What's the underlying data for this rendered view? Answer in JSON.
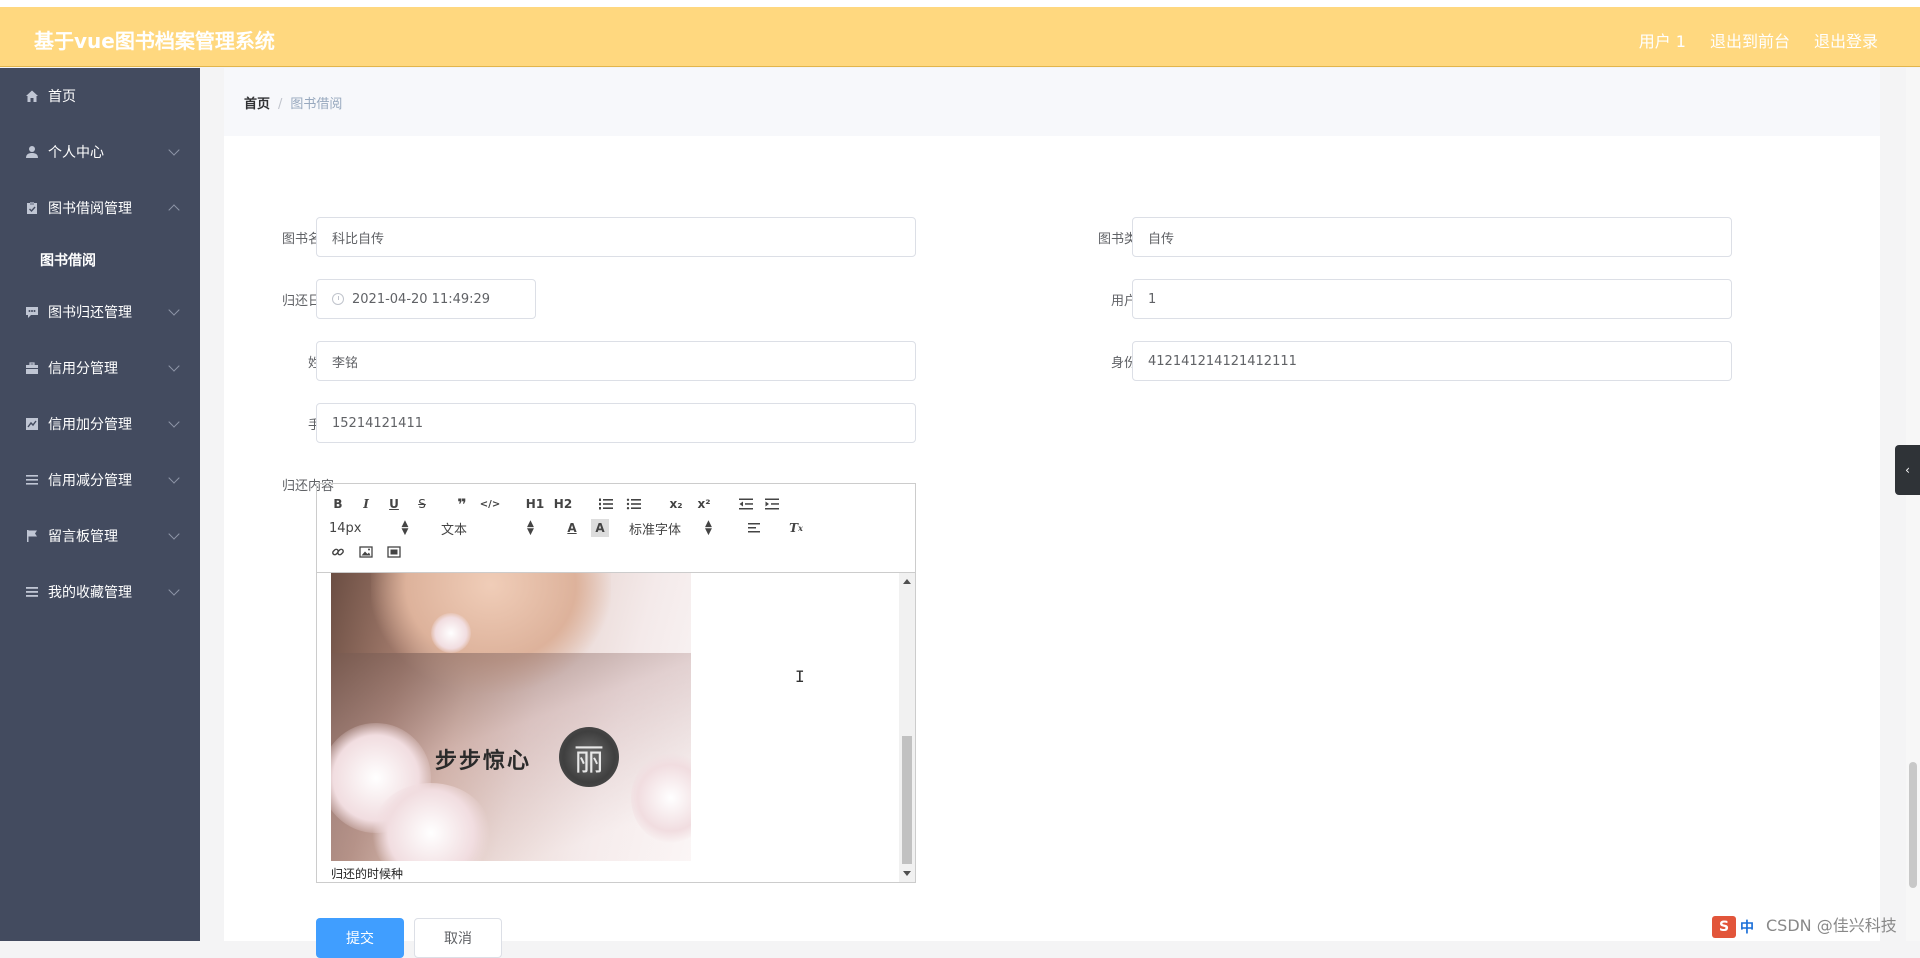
{
  "header": {
    "title": "基于vue图书档案管理系统",
    "links": [
      "用户 1",
      "退出到前台",
      "退出登录"
    ]
  },
  "sidebar": {
    "items": [
      {
        "label": "首页",
        "icon": "home-icon"
      },
      {
        "label": "个人中心",
        "icon": "user-icon"
      },
      {
        "label": "图书借阅管理",
        "icon": "clipboard-icon",
        "sub": [
          "图书借阅"
        ]
      },
      {
        "label": "图书归还管理",
        "icon": "comment-icon"
      },
      {
        "label": "信用分管理",
        "icon": "briefcase-icon"
      },
      {
        "label": "信用加分管理",
        "icon": "chart-icon"
      },
      {
        "label": "信用减分管理",
        "icon": "list-icon"
      },
      {
        "label": "留言板管理",
        "icon": "flag-icon"
      },
      {
        "label": "我的收藏管理",
        "icon": "menu-icon"
      }
    ]
  },
  "breadcrumb": {
    "home": "首页",
    "sep": "/",
    "current": "图书借阅"
  },
  "form": {
    "book_name": {
      "label": "图书名称",
      "value": "科比自传"
    },
    "book_type": {
      "label": "图书类型",
      "value": "自传"
    },
    "return_date": {
      "label": "归还日期",
      "value": "2021-04-20 11:49:29"
    },
    "username": {
      "label": "用户名",
      "value": "1"
    },
    "name": {
      "label": "姓名",
      "value": "李铭"
    },
    "id_card": {
      "label": "身份证",
      "value": "412141214121412111"
    },
    "phone": {
      "label": "手机",
      "value": "15214121411"
    },
    "content": {
      "label": "归还内容",
      "text": "归还的时候种",
      "image_caption": "步步惊心",
      "seal_char": "丽"
    }
  },
  "editor_toolbar": {
    "buttons_row1": [
      "B",
      "I",
      "U",
      "S",
      "❞",
      "</>",
      "H1",
      "H2",
      "ol",
      "ul",
      "x₂",
      "x²",
      "outdent",
      "indent"
    ],
    "size": "14px",
    "header": "文本",
    "font": "标准字体"
  },
  "actions": {
    "submit": "提交",
    "cancel": "取消"
  },
  "overlay": {
    "watermark": "CSDN @佳兴科技",
    "ime": "中"
  }
}
